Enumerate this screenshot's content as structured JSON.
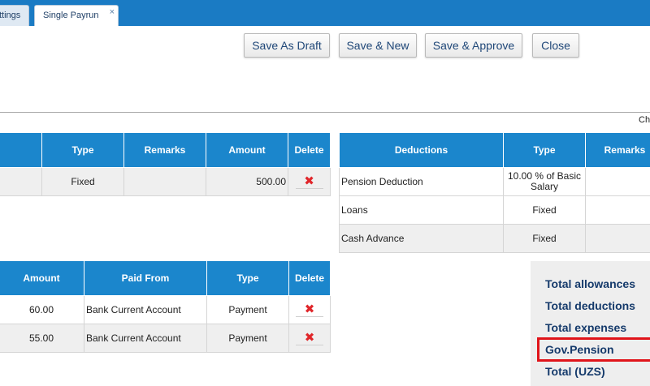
{
  "tabs": [
    {
      "label": "ttings"
    },
    {
      "label": "Single Payrun",
      "close": "×"
    }
  ],
  "toolbar": {
    "save_draft": "Save As Draft",
    "save_new": "Save & New",
    "save_approve": "Save & Approve",
    "close": "Close"
  },
  "cut_label": "Ch",
  "allowances": {
    "headers": [
      "",
      "Type",
      "Remarks",
      "Amount",
      "Delete"
    ],
    "rows": [
      {
        "name": "",
        "type": "Fixed",
        "remarks": "",
        "amount": "500.00"
      }
    ]
  },
  "deductions": {
    "headers": [
      "Deductions",
      "Type",
      "Remarks"
    ],
    "rows": [
      {
        "name": "Pension Deduction",
        "type": "10.00 % of Basic Salary",
        "remarks": ""
      },
      {
        "name": "Loans",
        "type": "Fixed",
        "remarks": ""
      },
      {
        "name": "Cash Advance",
        "type": "Fixed",
        "remarks": ""
      }
    ]
  },
  "expenses": {
    "headers": [
      "Amount",
      "Paid From",
      "Type",
      "Delete"
    ],
    "rows": [
      {
        "amount": "60.00",
        "paid_from": "Bank Current Account",
        "type": "Payment"
      },
      {
        "amount": "55.00",
        "paid_from": "Bank Current Account",
        "type": "Payment"
      }
    ]
  },
  "totals": {
    "allowances": "Total allowances",
    "deductions": "Total deductions",
    "expenses": "Total expenses",
    "gov_pension": "Gov.Pension",
    "total": "Total (UZS)"
  },
  "icons": {
    "delete": "✖"
  },
  "colors": {
    "header_bg": "#1b86cc",
    "tabbar_bg": "#1a7bc4",
    "highlight": "#e0141a",
    "delete_icon": "#e0262a",
    "totals_text": "#153a6b"
  }
}
